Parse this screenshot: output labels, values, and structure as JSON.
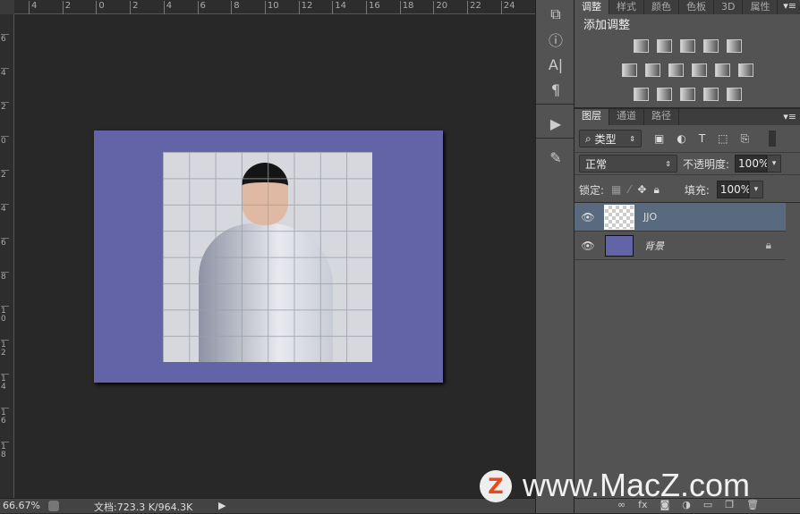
{
  "rulers": {
    "top": [
      "4",
      "2",
      "0",
      "2",
      "4",
      "6",
      "8",
      "10",
      "12",
      "14",
      "16",
      "18",
      "20",
      "22",
      "24"
    ],
    "left": [
      "6",
      "4",
      "2",
      "0",
      "2",
      "4",
      "6",
      "8",
      "10",
      "12",
      "14",
      "16",
      "18"
    ]
  },
  "colors": {
    "canvas_bg": "#6264a7",
    "selected_layer": "#596a7f"
  },
  "status": {
    "zoom": "66.67%",
    "doc": "文档:723.3 K/964.3K"
  },
  "tools": [
    "history-icon",
    "info-icon",
    "character-icon",
    "paragraph-icon",
    "play-icon",
    "brush-presets-icon"
  ],
  "adjust_panel": {
    "tabs": [
      "调整",
      "样式",
      "颜色",
      "色板",
      "3D",
      "属性"
    ],
    "title": "添加调整"
  },
  "layers_panel": {
    "tabs": [
      "图层",
      "通道",
      "路径"
    ],
    "filter": "类型",
    "blend_mode": "正常",
    "opacity_label": "不透明度:",
    "opacity": "100%",
    "lock_label": "锁定:",
    "fill_label": "填充:",
    "fill": "100%",
    "layers": [
      {
        "name": "JJO",
        "visible": true,
        "selected": true
      },
      {
        "name": "背景",
        "visible": true,
        "locked": true
      }
    ]
  },
  "watermark": "www.MacZ.com"
}
